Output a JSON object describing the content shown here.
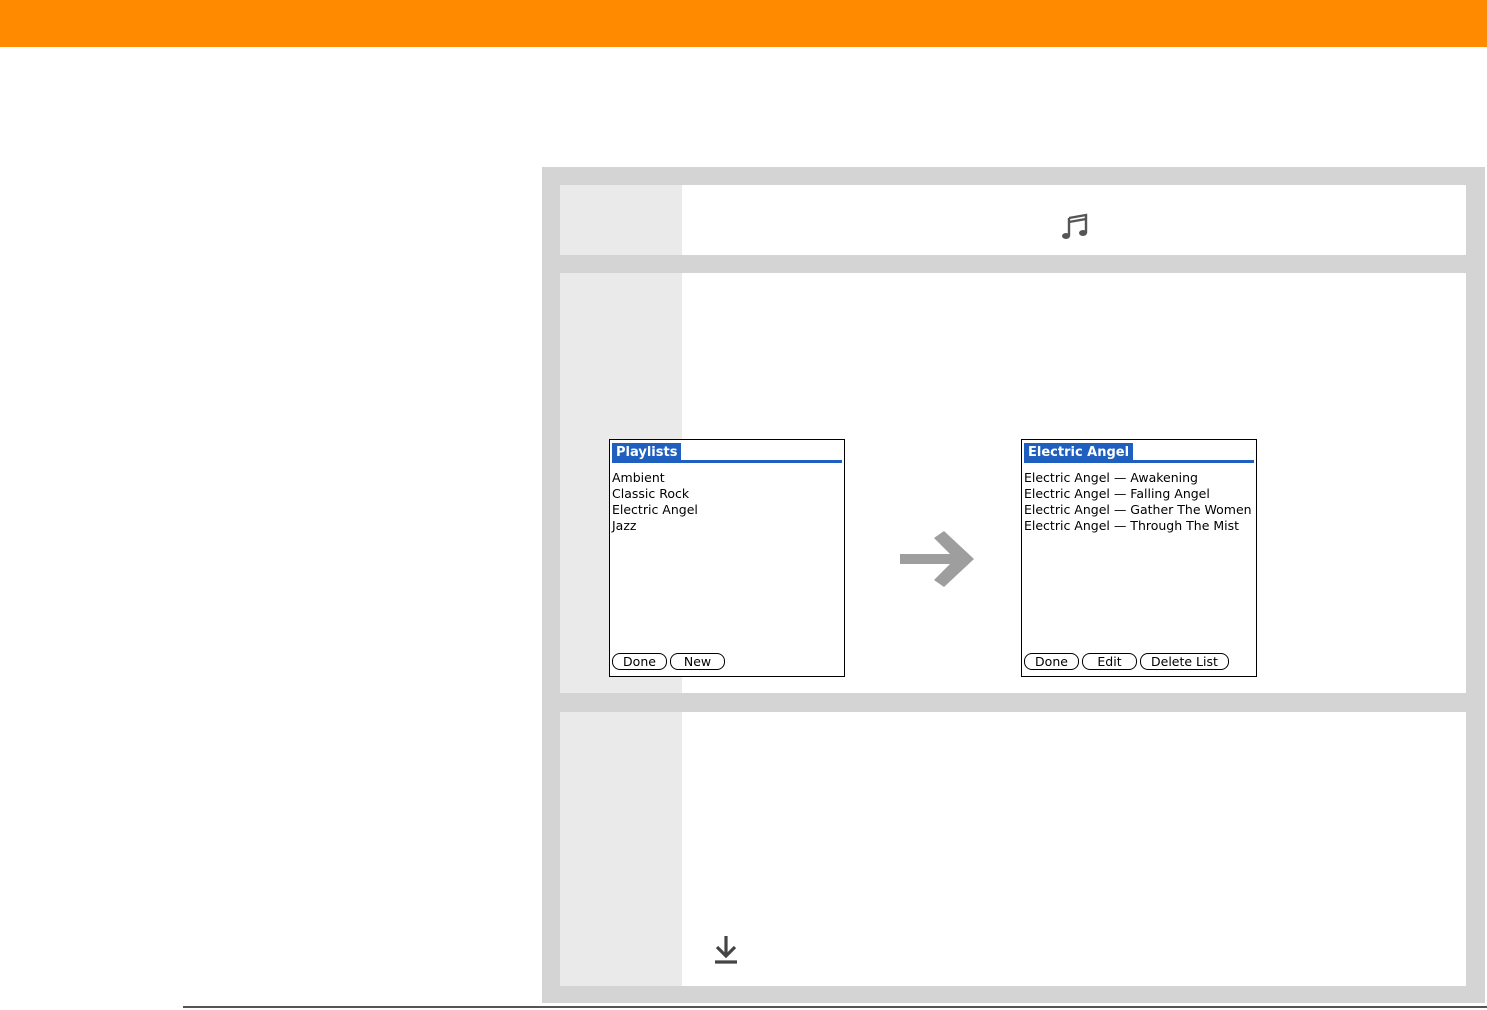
{
  "header": {
    "bar_color": "#FF8A00"
  },
  "icons": {
    "music": "music-note-icon",
    "transition": "right-arrow-icon",
    "download": "download-arrow-icon"
  },
  "screens": {
    "playlists": {
      "title": "Playlists",
      "items": [
        "Ambient",
        "Classic Rock",
        "Electric Angel",
        "Jazz"
      ],
      "buttons": {
        "done": "Done",
        "new": "New"
      }
    },
    "electric_angel": {
      "title": "Electric Angel",
      "items": [
        "Electric Angel — Awakening",
        "Electric Angel — Falling Angel",
        "Electric Angel — Gather The Women",
        "Electric Angel — Through The  Mist"
      ],
      "buttons": {
        "done": "Done",
        "edit": "Edit",
        "delete_list": "Delete List"
      }
    }
  },
  "colors": {
    "accent_orange": "#FF8A00",
    "palm_blue": "#1E5FBF",
    "panel_gray": "#D4D4D4",
    "step_number_gray": "#EAEAEA"
  }
}
